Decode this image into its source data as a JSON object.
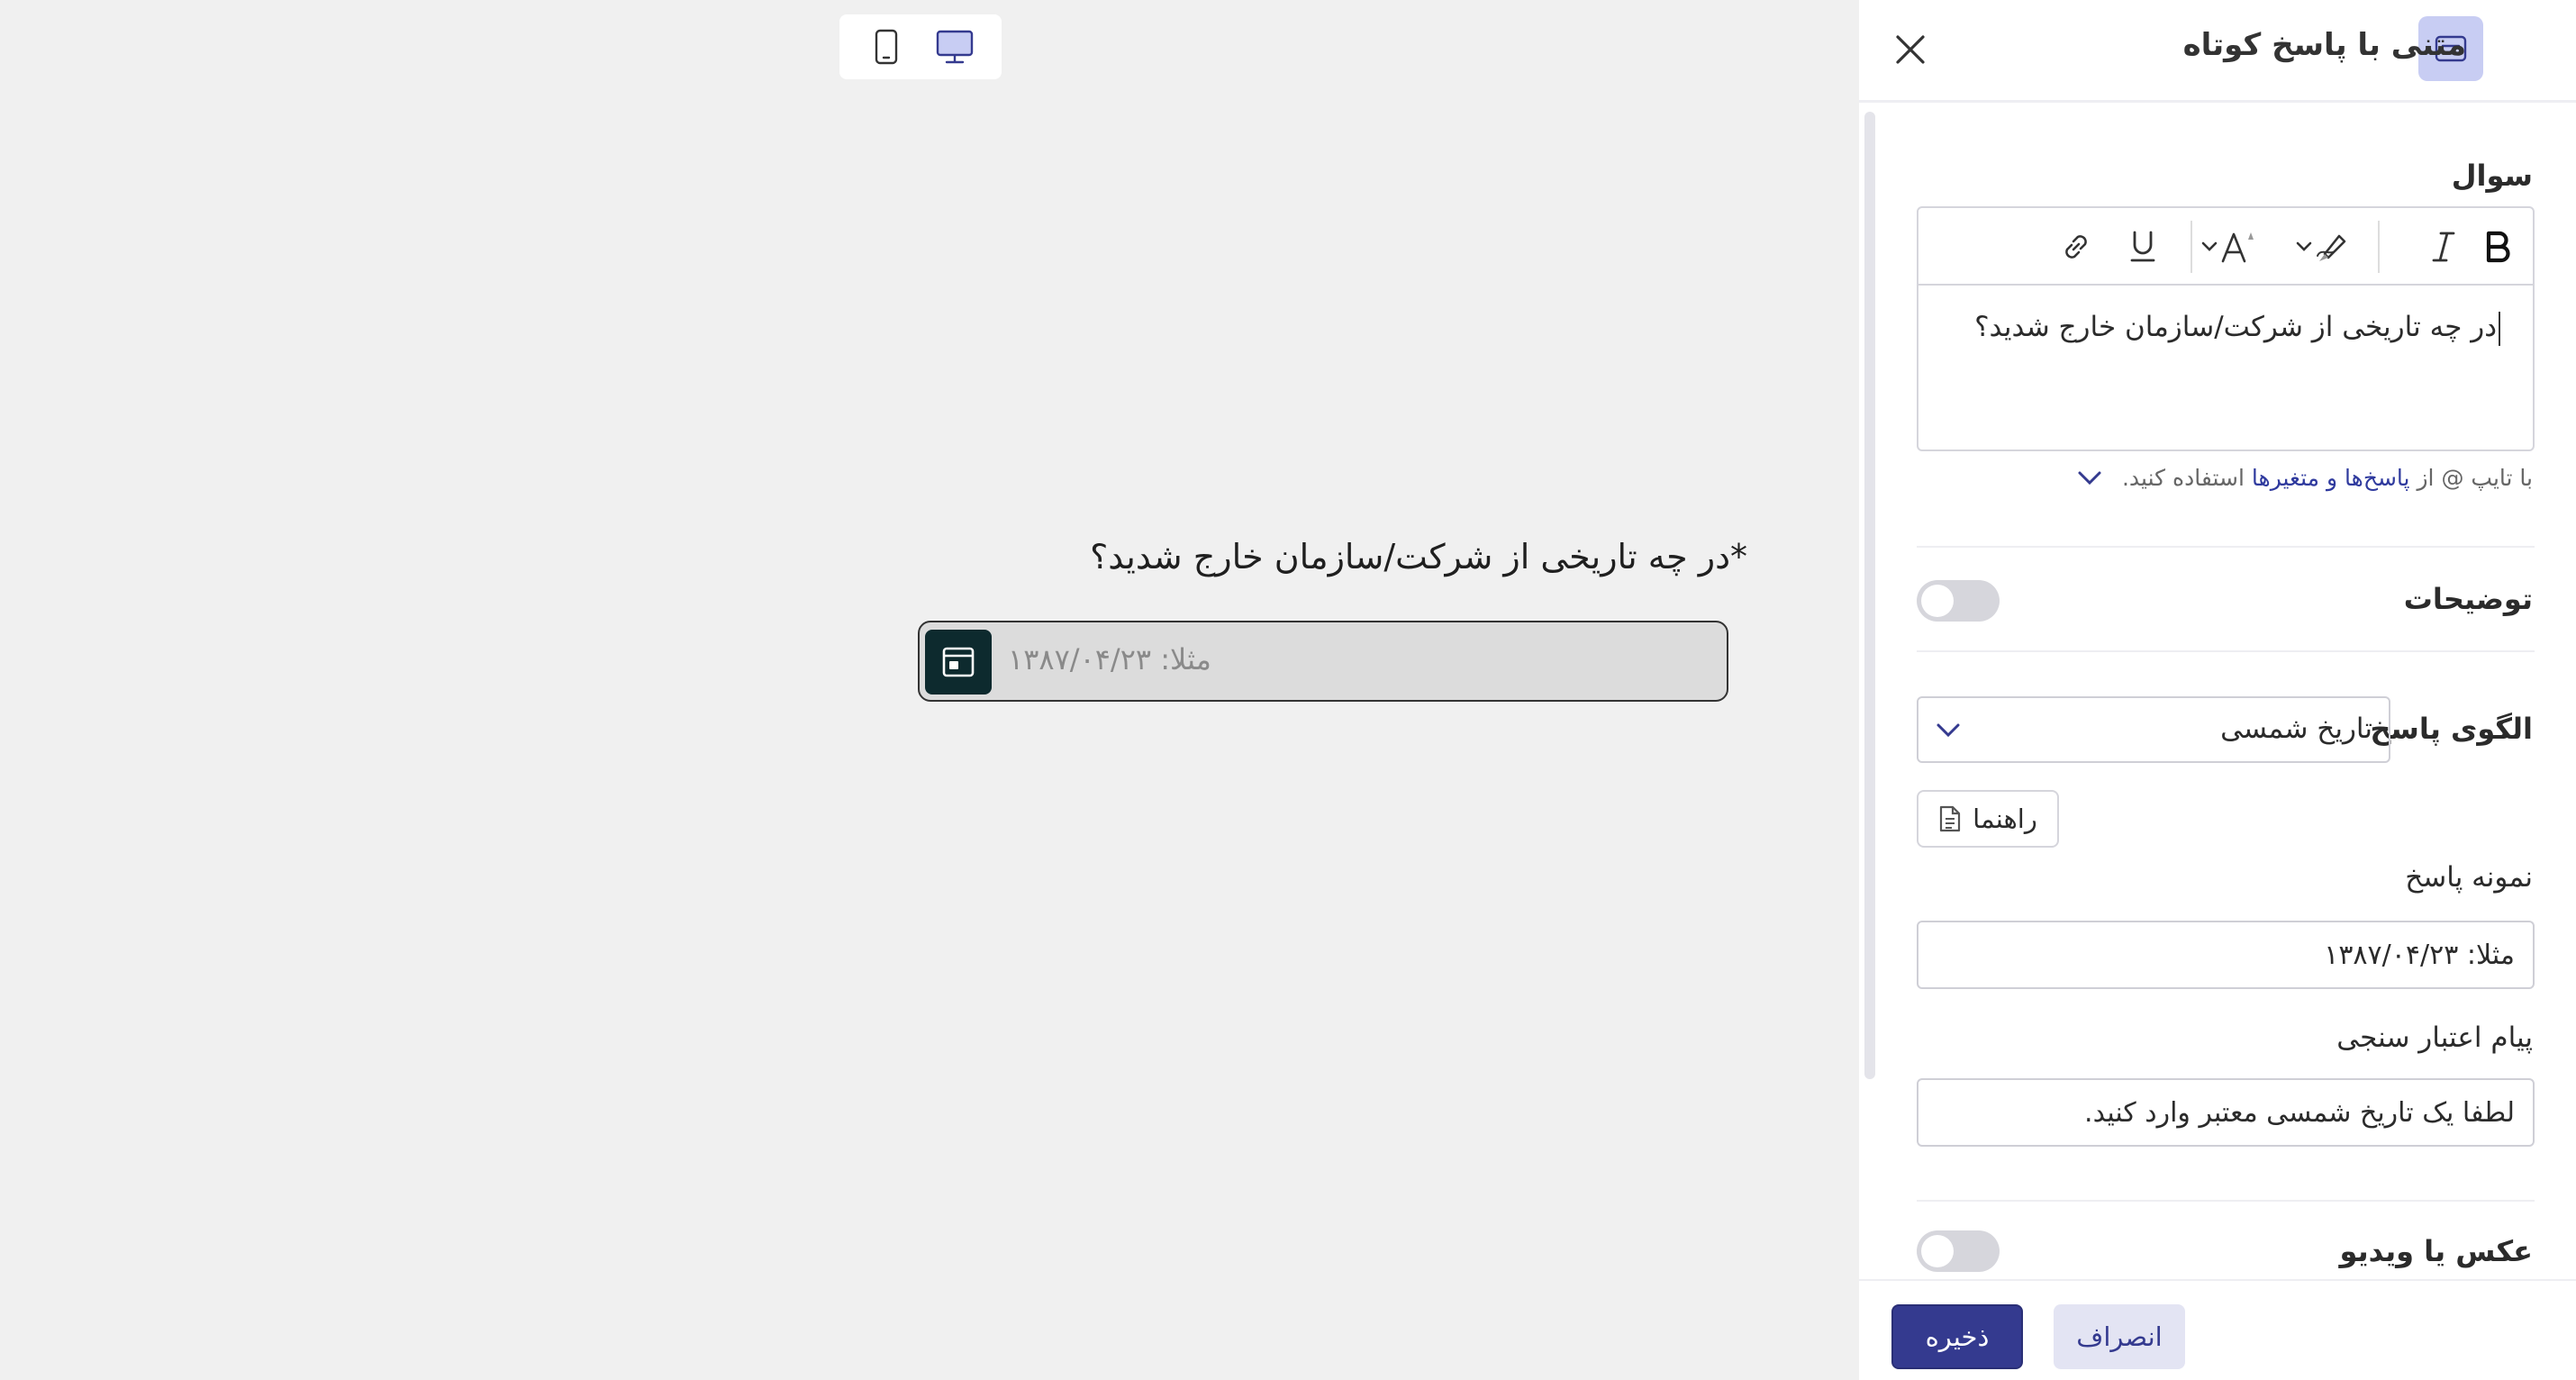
{
  "preview": {
    "question": "*در چه تاریخی از شرکت/سازمان خارج شدید؟",
    "answer_placeholder": "مثلا: ۱۳۸۷/۰۴/۲۳"
  },
  "panel": {
    "title": "متنی با پاسخ کوتاه",
    "question_label": "سوال",
    "question_text": "در چه تاریخی از شرکت/سازمان خارج شدید؟",
    "hint_prefix": "با تایپ @ از",
    "hint_link": "پاسخ‌ها و متغیرها",
    "hint_suffix": "استفاده کنید.",
    "description_label": "توضیحات",
    "pattern_label": "الگوی پاسخ",
    "pattern_value": "تاریخ شمسی",
    "guide_label": "راهنما",
    "sample_label": "نمونه پاسخ",
    "sample_value": "مثلا: ۱۳۸۷/۰۴/۲۳",
    "validation_label": "پیام اعتبار سنجی",
    "validation_value": "لطفا یک تاریخ شمسی معتبر وارد کنید.",
    "media_label": "عکس یا ویدیو"
  },
  "footer": {
    "save_label": "ذخیره",
    "cancel_label": "انصراف"
  },
  "colors": {
    "accent": "#343a8f",
    "accent_light": "#e3e4f3",
    "icon_bg": "#c8cdf3",
    "input_icon_bg": "#0d2a2e"
  },
  "icons": {
    "mobile": "mobile-phone-icon",
    "desktop": "desktop-monitor-icon",
    "close": "close-icon",
    "type": "short-text-icon",
    "calendar": "calendar-icon",
    "guide": "document-icon"
  }
}
